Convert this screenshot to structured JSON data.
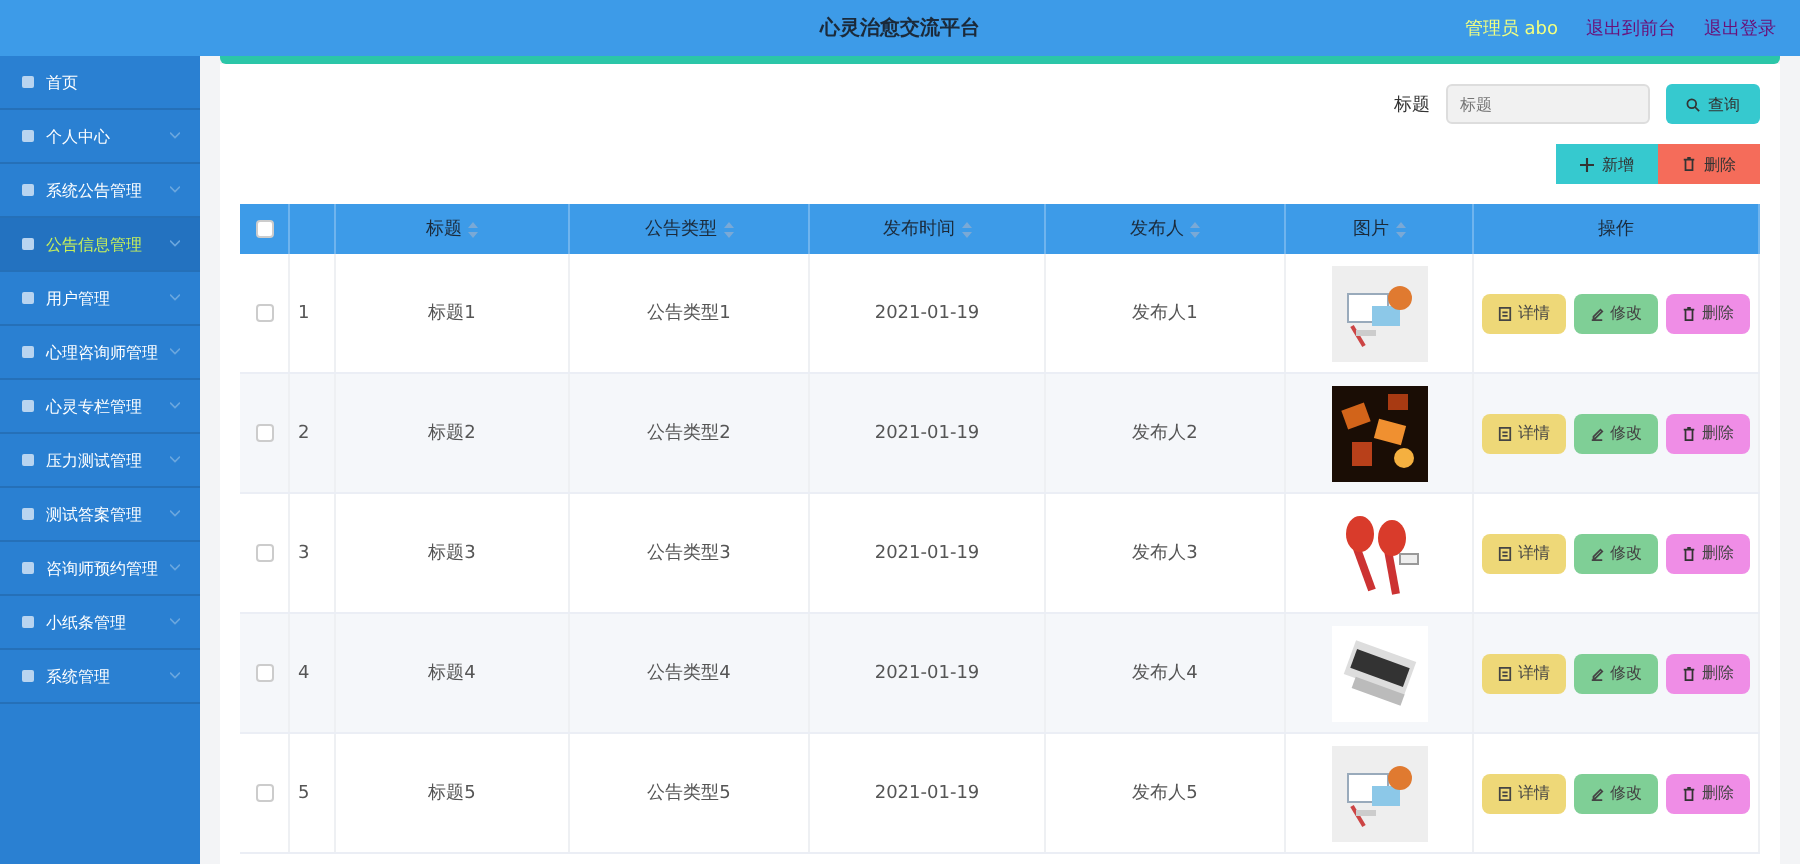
{
  "header": {
    "title": "心灵治愈交流平台",
    "user": "管理员 abo",
    "links": [
      "退出到前台",
      "退出登录"
    ]
  },
  "sidebar": {
    "items": [
      {
        "label": "首页",
        "selected": false
      },
      {
        "label": "个人中心",
        "selected": false
      },
      {
        "label": "系统公告管理",
        "selected": false
      },
      {
        "label": "公告信息管理",
        "selected": true
      },
      {
        "label": "用户管理",
        "selected": false
      },
      {
        "label": "心理咨询师管理",
        "selected": false
      },
      {
        "label": "心灵专栏管理",
        "selected": false
      },
      {
        "label": "压力测试管理",
        "selected": false
      },
      {
        "label": "测试答案管理",
        "selected": false
      },
      {
        "label": "咨询师预约管理",
        "selected": false
      },
      {
        "label": "小纸条管理",
        "selected": false
      },
      {
        "label": "系统管理",
        "selected": false
      }
    ]
  },
  "search": {
    "label": "标题",
    "placeholder": "标题",
    "button": "查询"
  },
  "actions": [
    {
      "kind": "add",
      "label": "新增"
    },
    {
      "kind": "delete",
      "label": "删除"
    }
  ],
  "table": {
    "select_all_checked": false,
    "columns": [
      "标题",
      "公告类型",
      "发布时间",
      "发布人",
      "图片",
      "操作"
    ],
    "rows": [
      {
        "index": "1",
        "title": "标题1",
        "type": "公告类型1",
        "date": "2021-01-19",
        "author": "发布人1",
        "checked": false,
        "buttons": [
          {
            "kind": "detail",
            "label": "详情"
          },
          {
            "kind": "edit",
            "label": "修改"
          },
          {
            "kind": "delete",
            "label": "删除"
          }
        ]
      },
      {
        "index": "2",
        "title": "标题2",
        "type": "公告类型2",
        "date": "2021-01-19",
        "author": "发布人2",
        "checked": false,
        "buttons": [
          {
            "kind": "detail",
            "label": "详情"
          },
          {
            "kind": "edit",
            "label": "修改"
          },
          {
            "kind": "delete",
            "label": "删除"
          }
        ]
      },
      {
        "index": "3",
        "title": "标题3",
        "type": "公告类型3",
        "date": "2021-01-19",
        "author": "发布人3",
        "checked": false,
        "buttons": [
          {
            "kind": "detail",
            "label": "详情"
          },
          {
            "kind": "edit",
            "label": "修改"
          },
          {
            "kind": "delete",
            "label": "删除"
          }
        ]
      },
      {
        "index": "4",
        "title": "标题4",
        "type": "公告类型4",
        "date": "2021-01-19",
        "author": "发布人4",
        "checked": false,
        "buttons": [
          {
            "kind": "detail",
            "label": "详情"
          },
          {
            "kind": "edit",
            "label": "修改"
          },
          {
            "kind": "delete",
            "label": "删除"
          }
        ]
      },
      {
        "index": "5",
        "title": "标题5",
        "type": "公告类型5",
        "date": "2021-01-19",
        "author": "发布人5",
        "checked": false,
        "buttons": [
          {
            "kind": "detail",
            "label": "详情"
          },
          {
            "kind": "edit",
            "label": "修改"
          },
          {
            "kind": "delete",
            "label": "删除"
          }
        ]
      }
    ]
  }
}
